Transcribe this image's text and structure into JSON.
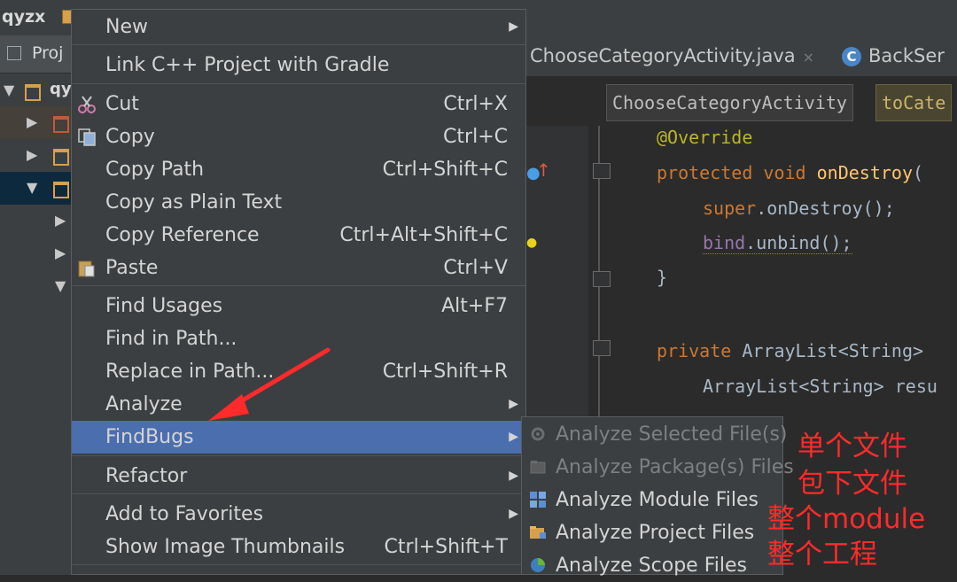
{
  "ide": {
    "project_crumb": "qyzx",
    "project_panel_title": "Proj",
    "tree_root_label": "qy",
    "tabs": [
      {
        "label": "ChooseCategoryActivity.java",
        "close": "×"
      },
      {
        "label": "BackSer",
        "icon_letter": "C"
      }
    ],
    "breadcrumbs": [
      "ChooseCategoryActivity",
      "toCate"
    ],
    "code_lines": [
      {
        "text": "@Override"
      },
      {
        "kw": "protected void ",
        "fn": "onDestroy",
        "rest": "("
      },
      {
        "pl": "super",
        "rest": ".onDestroy();"
      },
      {
        "pl": "bind",
        "rest": ".unbind();"
      },
      {
        "rest": "}"
      },
      {
        "kw": "private ",
        "rest": "ArrayList<String> "
      },
      {
        "rest": "ArrayList<String> resu"
      }
    ]
  },
  "context_menu": {
    "items": [
      {
        "label": "New",
        "submenu": true
      },
      {
        "label": "Link C++ Project with Gradle"
      },
      {
        "label": "Cut",
        "shortcut": "Ctrl+X",
        "icon": "scissors-icon"
      },
      {
        "label": "Copy",
        "shortcut": "Ctrl+C",
        "icon": "copy-icon"
      },
      {
        "label": "Copy Path",
        "shortcut": "Ctrl+Shift+C"
      },
      {
        "label": "Copy as Plain Text"
      },
      {
        "label": "Copy Reference",
        "shortcut": "Ctrl+Alt+Shift+C"
      },
      {
        "label": "Paste",
        "shortcut": "Ctrl+V",
        "icon": "paste-icon"
      },
      {
        "label": "Find Usages",
        "shortcut": "Alt+F7"
      },
      {
        "label": "Find in Path..."
      },
      {
        "label": "Replace in Path...",
        "shortcut": "Ctrl+Shift+R"
      },
      {
        "label": "Analyze",
        "submenu": true
      },
      {
        "label": "FindBugs",
        "submenu": true,
        "selected": true
      },
      {
        "label": "Refactor",
        "submenu": true
      },
      {
        "label": "Add to Favorites",
        "submenu": true
      },
      {
        "label": "Show Image Thumbnails",
        "shortcut": "Ctrl+Shift+T"
      }
    ]
  },
  "findbugs_submenu": {
    "items": [
      {
        "label": "Analyze Selected File(s)",
        "enabled": false
      },
      {
        "label": "Analyze Package(s) Files",
        "enabled": false
      },
      {
        "label": "Analyze Module Files",
        "enabled": true
      },
      {
        "label": "Analyze Project Files",
        "enabled": true
      },
      {
        "label": "Analyze Scope Files",
        "enabled": true
      }
    ]
  },
  "annotations": [
    "单个文件",
    "包下文件",
    "整个module",
    "整个工程"
  ],
  "colors": {
    "selection": "#4b6eaf",
    "annotation_red": "#ff2a2a",
    "menu_bg": "#3c3f41"
  }
}
